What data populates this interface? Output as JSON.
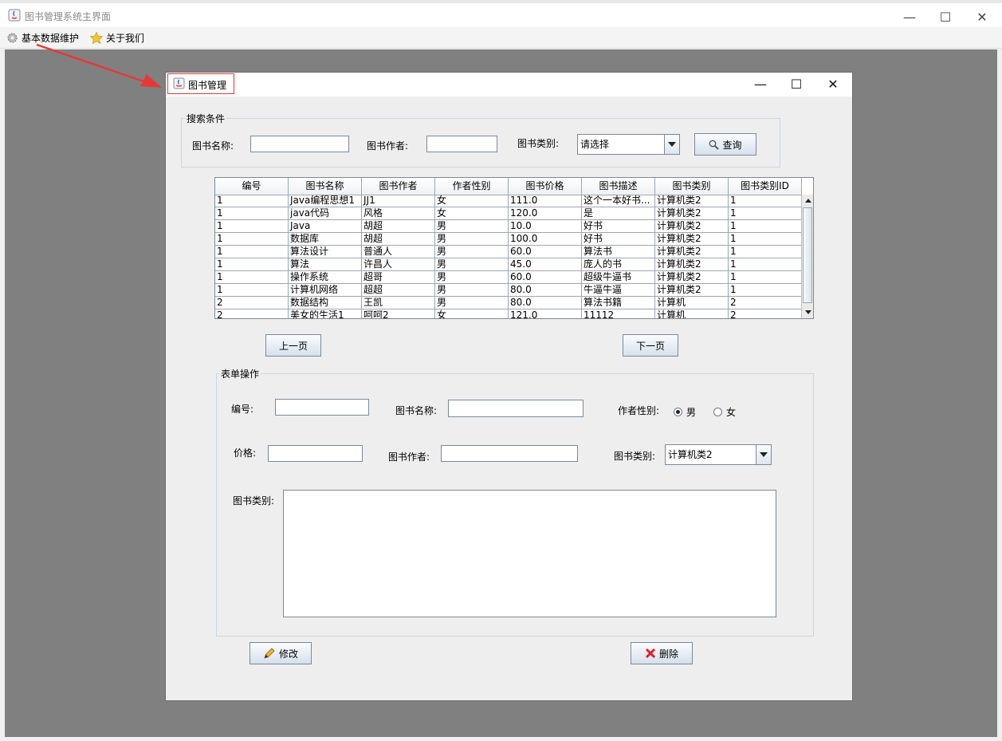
{
  "window": {
    "title": "图书管理系统主界面",
    "controls": {
      "minimize": "—",
      "maximize": "☐",
      "close": "✕"
    }
  },
  "menubar": {
    "items": [
      {
        "label": "基本数据维护",
        "icon": "gear-icon"
      },
      {
        "label": "关于我们",
        "icon": "star-icon"
      }
    ]
  },
  "internal_frame": {
    "title": "图书管理",
    "controls": {
      "minimize": "—",
      "maximize": "☐",
      "close": "✕"
    }
  },
  "search": {
    "group_title": "搜索条件",
    "name_label": "图书名称:",
    "name_value": "",
    "author_label": "图书作者:",
    "author_value": "",
    "type_label": "图书类别:",
    "type_selected": "请选择",
    "query_button": "查询"
  },
  "table": {
    "columns": [
      "编号",
      "图书名称",
      "图书作者",
      "作者性别",
      "图书价格",
      "图书描述",
      "图书类别",
      "图书类别ID"
    ],
    "rows": [
      [
        "1",
        "Java编程思想1",
        "JJ1",
        "女",
        "111.0",
        "这个一本好书...",
        "计算机类2",
        "1"
      ],
      [
        "1",
        "java代码",
        "风格",
        "女",
        "120.0",
        "是",
        "计算机类2",
        "1"
      ],
      [
        "1",
        "Java",
        "胡超",
        "男",
        "10.0",
        "好书",
        "计算机类2",
        "1"
      ],
      [
        "1",
        "数据库",
        "胡超",
        "男",
        "100.0",
        "好书",
        "计算机类2",
        "1"
      ],
      [
        "1",
        "算法设计",
        "普通人",
        "男",
        "60.0",
        "算法书",
        "计算机类2",
        "1"
      ],
      [
        "1",
        "算法",
        "许昌人",
        "男",
        "45.0",
        "庞人的书",
        "计算机类2",
        "1"
      ],
      [
        "1",
        "操作系统",
        "超哥",
        "男",
        "60.0",
        "超级牛逼书",
        "计算机类2",
        "1"
      ],
      [
        "1",
        "计算机网络",
        "超超",
        "男",
        "80.0",
        "牛逼牛逼",
        "计算机类2",
        "1"
      ],
      [
        "2",
        "数据结构",
        "王凯",
        "男",
        "80.0",
        "算法书籍",
        "计算机",
        "2"
      ],
      [
        "2",
        "美女的生活1",
        "呵呵2",
        "女",
        "121.0",
        "11112",
        "计算机",
        "2"
      ]
    ]
  },
  "pager": {
    "prev": "上一页",
    "next": "下一页"
  },
  "form": {
    "group_title": "表单操作",
    "id_label": "编号:",
    "id_value": "",
    "name_label": "图书名称:",
    "name_value": "",
    "gender_label": "作者性别:",
    "gender_male": "男",
    "gender_female": "女",
    "gender_selected": "男",
    "price_label": "价格:",
    "price_value": "",
    "author_label": "图书作者:",
    "author_value": "",
    "type_label": "图书类别:",
    "type_selected": "计算机类2",
    "desc_label": "图书类别:",
    "desc_value": ""
  },
  "actions": {
    "modify": "修改",
    "delete": "删除"
  },
  "colors": {
    "desktop": "#808080",
    "annotation_red": "#e53935",
    "group_border": "#c6d6e6"
  }
}
